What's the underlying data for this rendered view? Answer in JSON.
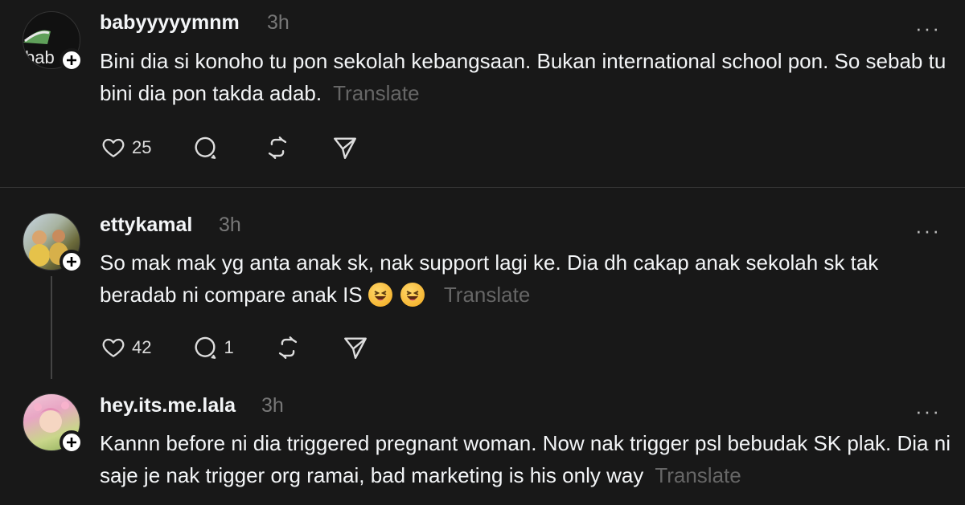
{
  "posts": [
    {
      "username": "babyyyyymnm",
      "time": "3h",
      "avatar_text": "bab",
      "text": "Bini dia si konoho tu pon sekolah kebangsaan. Bukan international school pon. So sebab tu bini dia pon takda adab.",
      "translate": "Translate",
      "likes": "25",
      "replies": "",
      "more": "···"
    },
    {
      "username": "ettykamal",
      "time": "3h",
      "text": "So mak mak yg anta anak sk, nak support lagi ke. Dia dh cakap anak sekolah sk tak beradab ni compare anak IS",
      "translate": "Translate",
      "likes": "42",
      "replies": "1",
      "more": "···"
    },
    {
      "username": "hey.its.me.lala",
      "time": "3h",
      "text": "Kannn before ni dia triggered pregnant woman. Now nak trigger psl bebudak SK plak. Dia ni saje je nak trigger org ramai, bad marketing is his only way",
      "translate": "Translate",
      "more": "···"
    }
  ],
  "icons": {
    "like": "heart-icon",
    "reply": "comment-icon",
    "repost": "repost-icon",
    "share": "send-icon",
    "follow": "plus-icon",
    "emoji": "grinning-squinting-face-emoji"
  },
  "colors": {
    "background": "#181818",
    "text": "#f3f5f7",
    "muted": "#777777",
    "divider": "#333333"
  }
}
